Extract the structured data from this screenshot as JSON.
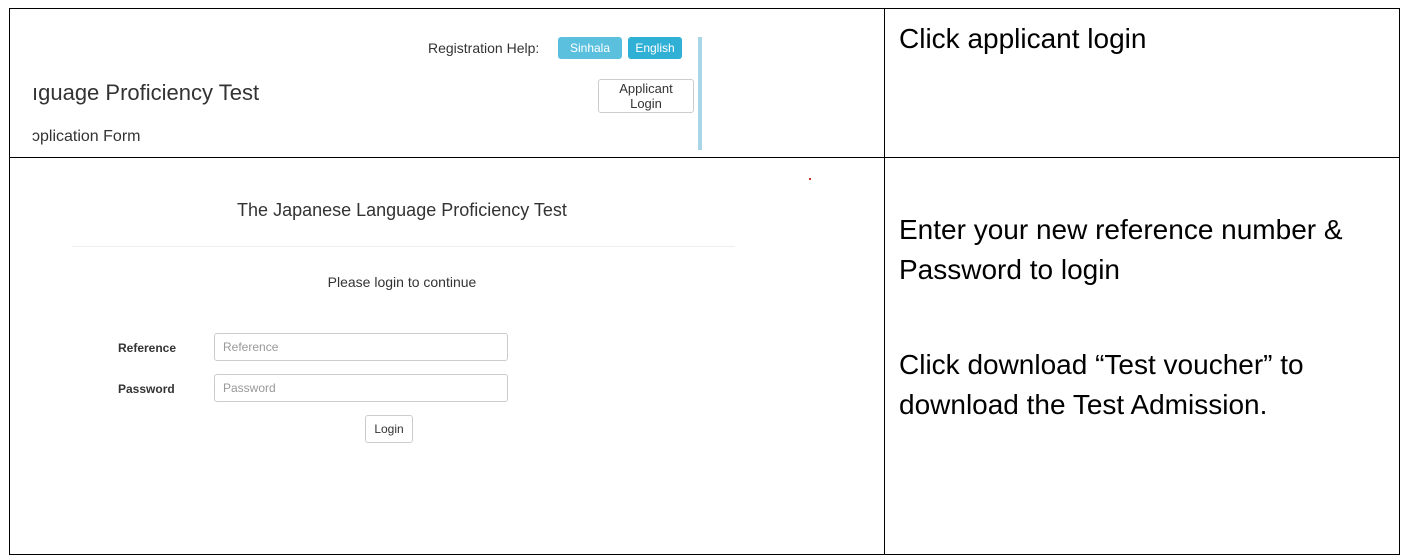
{
  "top_panel": {
    "registration_help_label": "Registration Help:",
    "sinhala_button": "Sinhala",
    "english_button": "English",
    "applicant_login_button": "Applicant Login",
    "test_title_partial": "ıguage Proficiency Test",
    "form_title_partial": "ɔplication Form"
  },
  "login_panel": {
    "title": "The Japanese Language Proficiency Test",
    "subtitle": "Please login to continue",
    "reference_label": "Reference",
    "reference_placeholder": "Reference",
    "reference_value": "",
    "password_label": "Password",
    "password_placeholder": "Password",
    "password_value": "",
    "login_button": "Login"
  },
  "instructions": {
    "step1": "Click applicant login",
    "step2": "Enter your new reference number & Password to login",
    "step3": "Click download “Test voucher” to download the Test Admission."
  },
  "colors": {
    "sinhala_button": "#5bc0de",
    "english_button": "#31b0d5",
    "panel_accent_bar": "#a9d6e6"
  }
}
